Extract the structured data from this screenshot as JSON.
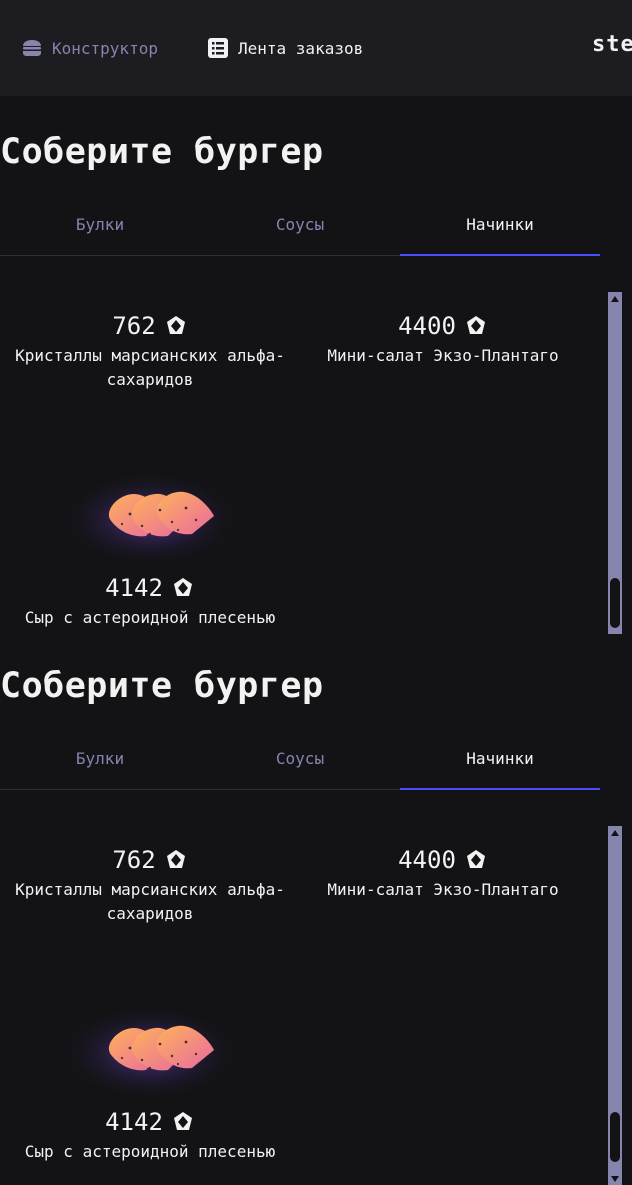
{
  "header": {
    "nav": [
      {
        "label": "Конструктор",
        "icon": "burger-icon"
      },
      {
        "label": "Лента заказов",
        "icon": "list-icon"
      }
    ],
    "logo_text": "ste"
  },
  "sections": [
    {
      "title": "Соберите бургер",
      "tabs": [
        {
          "label": "Булки",
          "active": false
        },
        {
          "label": "Соусы",
          "active": false
        },
        {
          "label": "Начинки",
          "active": true
        }
      ],
      "items": [
        {
          "price": "762",
          "name": "Кристаллы марсианских альфа-\nсахаридов"
        },
        {
          "price": "4400",
          "name": "Мини-салат Экзо-Плантаго"
        },
        {
          "price": "4142",
          "name": "Сыр с астероидной плесенью",
          "image": "cheese-image"
        }
      ]
    },
    {
      "title": "Соберите бургер",
      "tabs": [
        {
          "label": "Булки",
          "active": false
        },
        {
          "label": "Соусы",
          "active": false
        },
        {
          "label": "Начинки",
          "active": true
        }
      ],
      "items": [
        {
          "price": "762",
          "name": "Кристаллы марсианских альфа-\nсахаридов"
        },
        {
          "price": "4400",
          "name": "Мини-салат Экзо-Плантаго"
        },
        {
          "price": "4142",
          "name": "Сыр с астероидной плесенью",
          "image": "cheese-image"
        }
      ]
    }
  ],
  "colors": {
    "background": "#131316",
    "header": "#1c1c21",
    "inactive": "#8585ad",
    "accent": "#4c4cff",
    "text": "#f2f2f3"
  }
}
